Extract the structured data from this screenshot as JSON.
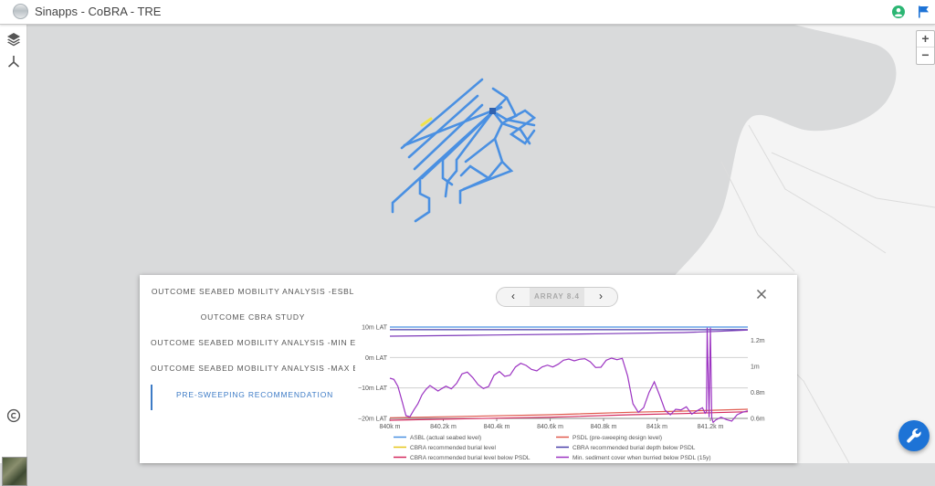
{
  "app": {
    "title": "Sinapps - CoBRA - TRE"
  },
  "map": {
    "zoom_in": "+",
    "zoom_out": "−"
  },
  "panel": {
    "layers": [
      "OUTCOME SEABED MOBILITY ANALYSIS -ESBL",
      "OUTCOME CBRA STUDY",
      "OUTCOME SEABED MOBILITY ANALYSIS -MIN ESBL",
      "OUTCOME SEABED MOBILITY ANALYSIS -MAX ESBL",
      "PRE-SWEEPING RECOMMENDATION"
    ],
    "active_layer": 4,
    "nav_label": "ARRAY 8.4",
    "nav_prev": "‹",
    "nav_next": "›"
  },
  "chart_data": {
    "type": "line",
    "x_tick_labels": [
      "840k m",
      "840.2k m",
      "840.4k m",
      "840.6k m",
      "840.8k m",
      "841k m",
      "841.2k m"
    ],
    "x_ticks": [
      840000,
      840200,
      840400,
      840600,
      840800,
      841000,
      841200
    ],
    "xlim": [
      840000,
      841340
    ],
    "y_left_tick_labels": [
      "10m LAT",
      "0m LAT",
      "−10m LAT",
      "−20m LAT"
    ],
    "y_left_ticks": [
      10,
      0,
      -10,
      -20
    ],
    "ylim_left": [
      -20,
      10
    ],
    "y_right_tick_labels": [
      "1.2m",
      "1m",
      "0.8m",
      "0.6m"
    ],
    "y_right_ticks": [
      1.2,
      1.0,
      0.8,
      0.6
    ],
    "ylim_right": [
      0.6,
      1.3
    ],
    "series": [
      {
        "name": "ASBL (actual seabed level)",
        "color": "#4a90e2",
        "axis": "left",
        "x": [
          840000,
          841340
        ],
        "y": [
          10,
          10
        ]
      },
      {
        "name": "PSDL (pre-sweeping design level)",
        "color": "#e05a4e",
        "axis": "left",
        "x": [
          840000,
          840300,
          840600,
          840900,
          841100,
          841340
        ],
        "y": [
          -19.8,
          -19.3,
          -18.8,
          -18.0,
          -17.6,
          -17.0
        ]
      },
      {
        "name": "CBRA recommended burial level",
        "color": "#e6c619",
        "axis": "left",
        "x": [],
        "y": []
      },
      {
        "name": "CBRA recommended burial depth below PSDL",
        "color": "#4a3fa8",
        "axis": "right",
        "x": [
          840000,
          841340
        ],
        "y": [
          1.28,
          1.28
        ]
      },
      {
        "name": "CBRA recommended burial level below PSDL",
        "color": "#d42a5e",
        "axis": "left",
        "x": [
          840000,
          840300,
          840600,
          840900,
          841100,
          841340
        ],
        "y": [
          -20.6,
          -20.1,
          -19.6,
          -18.8,
          -18.4,
          -17.8
        ]
      },
      {
        "name": "Min. sediment cover when burried below PSDL (15y)",
        "color": "#9c34c2",
        "axis": "left",
        "x": [
          840000,
          840015,
          840030,
          840045,
          840060,
          840075,
          840090,
          840105,
          840120,
          840135,
          840150,
          840165,
          840180,
          840195,
          840210,
          840230,
          840250,
          840270,
          840290,
          840310,
          840330,
          840350,
          840370,
          840390,
          840410,
          840430,
          840450,
          840470,
          840490,
          840510,
          840530,
          840550,
          840570,
          840590,
          840610,
          840630,
          840650,
          840670,
          840690,
          840710,
          840730,
          840750,
          840770,
          840790,
          840810,
          840830,
          840850,
          840870,
          840890,
          840910,
          840930,
          840950,
          840970,
          840990,
          841010,
          841030,
          841050,
          841070,
          841090,
          841110,
          841130,
          841150,
          841170,
          841180,
          841185,
          841188,
          841195,
          841200,
          841205,
          841210,
          841220,
          841240,
          841260,
          841280,
          841300,
          841320,
          841340
        ],
        "y": [
          -6.8,
          -7.2,
          -9.5,
          -14.2,
          -19.1,
          -19.5,
          -17.2,
          -15.2,
          -12.3,
          -10.5,
          -9.2,
          -10.1,
          -11.0,
          -10.2,
          -9.4,
          -10.3,
          -8.5,
          -5.4,
          -4.8,
          -6.6,
          -8.9,
          -10.2,
          -9.5,
          -5.8,
          -4.6,
          -6.2,
          -5.8,
          -3.1,
          -1.9,
          -2.6,
          -3.9,
          -4.4,
          -3.1,
          -2.5,
          -3.1,
          -2.2,
          -0.9,
          -0.5,
          -1.1,
          -0.6,
          -0.4,
          -1.4,
          -3.3,
          -3.2,
          -0.9,
          -0.2,
          -0.7,
          -0.3,
          -6.1,
          -15.2,
          -18.0,
          -16.5,
          -11.5,
          -8.0,
          -12.5,
          -17.3,
          -18.8,
          -17.0,
          -17.2,
          -16.2,
          -18.6,
          -17.5,
          -16.5,
          -18.3,
          -17.8,
          9.8,
          -19.6,
          9.8,
          -19.8,
          -21.3,
          -20.5,
          -19.6,
          -20.4,
          -20.9,
          -18.8,
          -18.0,
          -17.5
        ]
      },
      {
        "name": "",
        "color": "#7e3ab9",
        "axis": "left",
        "x": [
          840000,
          840400,
          840800,
          841100,
          841230,
          841340
        ],
        "y": [
          7.0,
          7.4,
          7.8,
          8.2,
          8.6,
          9.0
        ]
      }
    ]
  }
}
